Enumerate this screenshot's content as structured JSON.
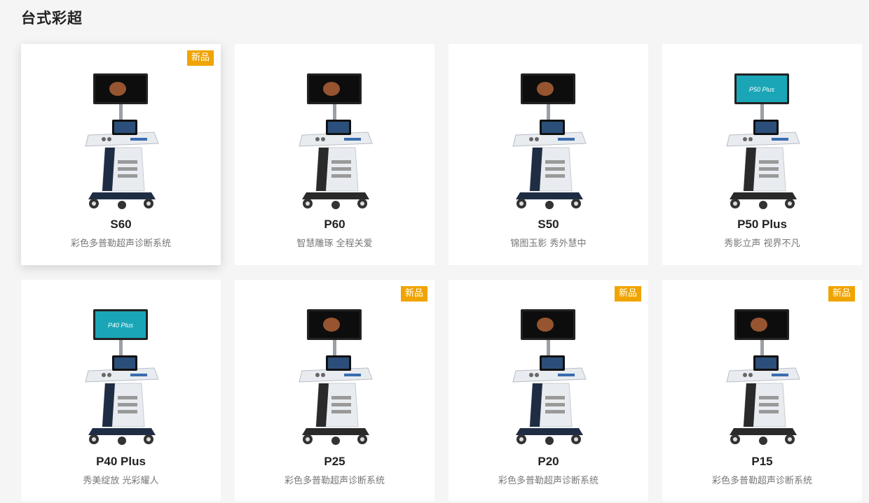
{
  "section": {
    "title": "台式彩超"
  },
  "products": [
    {
      "name": "S60",
      "desc": "彩色多普勒超声诊断系统",
      "badge": "新品",
      "image": "ultrasound-cart-s60"
    },
    {
      "name": "P60",
      "desc": "智慧雕琢 全程关爱",
      "badge": "",
      "image": "ultrasound-cart-p60"
    },
    {
      "name": "S50",
      "desc": "锦图玉影 秀外慧中",
      "badge": "",
      "image": "ultrasound-cart-s50"
    },
    {
      "name": "P50 Plus",
      "desc": "秀影立声 视界不凡",
      "badge": "",
      "image": "ultrasound-cart-p50-plus",
      "screen_label": "P50 Plus"
    },
    {
      "name": "P40 Plus",
      "desc": "秀美绽放 光彩耀人",
      "badge": "",
      "image": "ultrasound-cart-p40-plus",
      "screen_label": "P40 Plus"
    },
    {
      "name": "P25",
      "desc": "彩色多普勒超声诊断系统",
      "badge": "新品",
      "image": "ultrasound-cart-p25"
    },
    {
      "name": "P20",
      "desc": "彩色多普勒超声诊断系统",
      "badge": "新品",
      "image": "ultrasound-cart-p20"
    },
    {
      "name": "P15",
      "desc": "彩色多普勒超声诊断系统",
      "badge": "新品",
      "image": "ultrasound-cart-p15"
    }
  ],
  "colors": {
    "badge": "#f0a400",
    "page_bg": "#f5f5f5",
    "card_bg": "#ffffff",
    "name_text": "#222222",
    "desc_text": "#777777"
  }
}
